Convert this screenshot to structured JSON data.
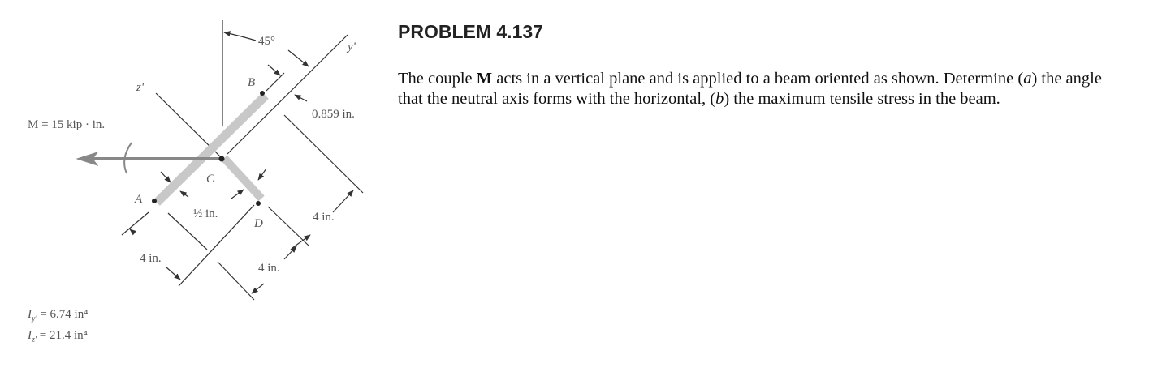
{
  "problem": {
    "title": "PROBLEM 4.137",
    "text_1": "The couple ",
    "text_M": "M",
    "text_2": " acts in a vertical plane and is applied to a beam oriented as shown. Determine (",
    "text_a": "a",
    "text_3": ") the angle that the neutral axis forms with the horizontal, (",
    "text_b": "b",
    "text_4": ") the maximum tensile stress in the beam."
  },
  "figure": {
    "angle": "45°",
    "y_axis": "y'",
    "z_axis": "z'",
    "moment": "M = 15 kip · in.",
    "dim_0859": "0.859 in.",
    "point_a": "A",
    "point_b": "B",
    "point_c": "C",
    "point_d": "D",
    "half_in": "½ in.",
    "dim_4_right": "4 in.",
    "dim_4_left": "4 in.",
    "dim_4_bottom": "4 in.",
    "iy": "I",
    "iy_sub": "y'",
    "iy_val": " = 6.74 in⁴",
    "iz": "I",
    "iz_sub": "z'",
    "iz_val": " = 21.4 in⁴",
    "beam_color": "#c8c8c8"
  }
}
